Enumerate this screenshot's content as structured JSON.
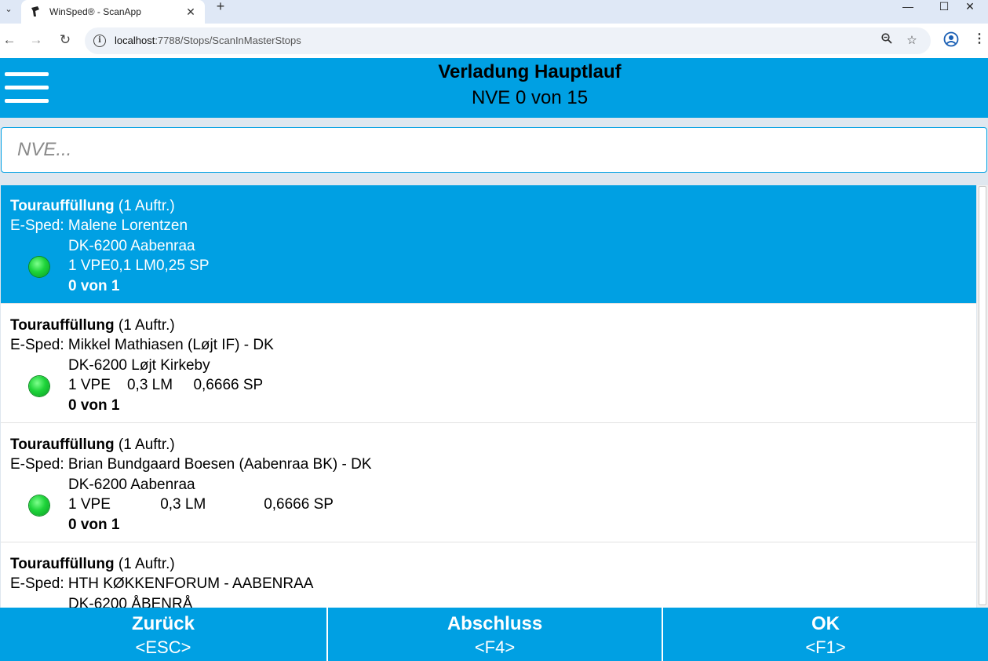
{
  "browser": {
    "tab_title": "WinSped® - ScanApp",
    "url_host": "localhost",
    "url_path": ":7788/Stops/ScanInMasterStops"
  },
  "header": {
    "title": "Verladung Hauptlauf",
    "subtitle": "NVE 0 von 15"
  },
  "search": {
    "placeholder": "NVE..."
  },
  "stops": [
    {
      "heading": "Tourauffüllung",
      "orders": "(1 Auftr.)",
      "consignee": "E-Sped: Malene Lorentzen",
      "address": "DK-6200 Aabenraa",
      "metrics": "1 VPE0,1 LM0,25 SP",
      "progress": "0 von 1",
      "status_color": "#1ed43a",
      "selected": true
    },
    {
      "heading": "Tourauffüllung",
      "orders": "(1 Auftr.)",
      "consignee": "E-Sped: Mikkel Mathiasen (Løjt IF) - DK",
      "address": "DK-6200 Løjt Kirkeby",
      "metrics": "1 VPE    0,3 LM     0,6666 SP",
      "progress": "0 von 1",
      "status_color": "#1ed43a",
      "selected": false
    },
    {
      "heading": "Tourauffüllung",
      "orders": "(1 Auftr.)",
      "consignee": "E-Sped: Brian Bundgaard Boesen (Aabenraa BK) - DK",
      "address": "DK-6200 Aabenraa",
      "metrics": "1 VPE            0,3 LM              0,6666 SP",
      "progress": "0 von 1",
      "status_color": "#1ed43a",
      "selected": false
    },
    {
      "heading": "Tourauffüllung",
      "orders": "(1 Auftr.)",
      "consignee": "E-Sped: HTH KØKKENFORUM - AABENRAA",
      "address": "DK-6200 ÅBENRÅ",
      "metrics": "",
      "progress": "",
      "status_color": "#1ed43a",
      "selected": false
    }
  ],
  "footer": {
    "back": {
      "label": "Zurück",
      "key": "<ESC>"
    },
    "close": {
      "label": "Abschluss",
      "key": "<F4>"
    },
    "ok": {
      "label": "OK",
      "key": "<F1>"
    }
  },
  "colors": {
    "accent": "#00a0e3",
    "status_ok": "#1ed43a"
  }
}
